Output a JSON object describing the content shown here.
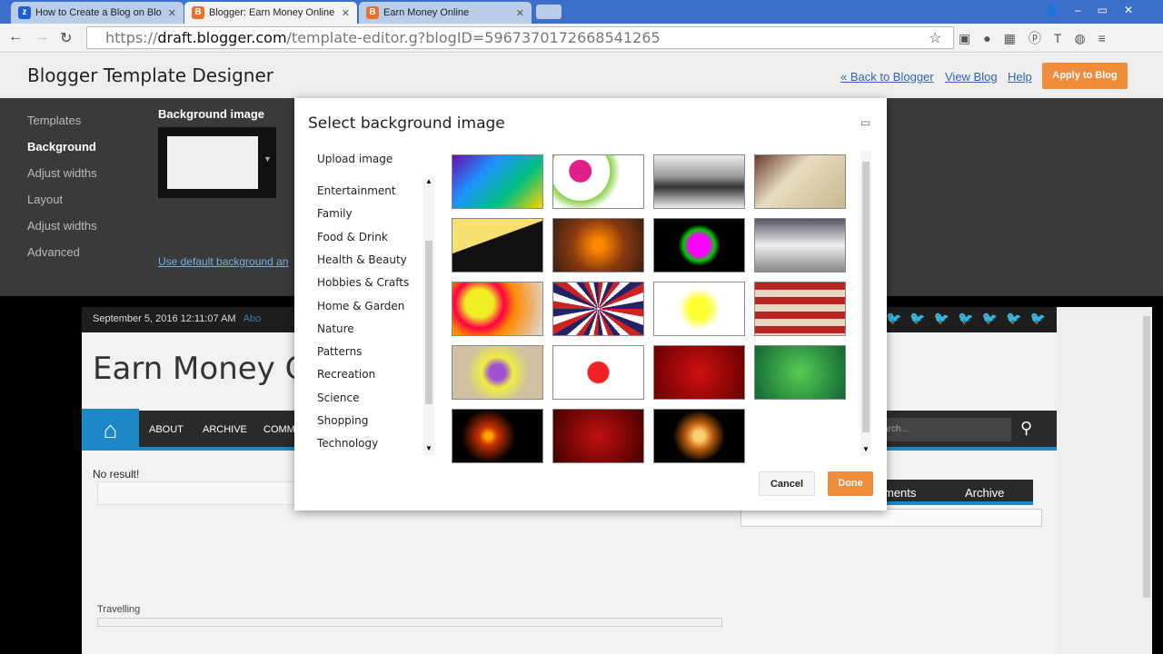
{
  "browser": {
    "tabs": [
      {
        "title": "How to Create a Blog on Blo",
        "icon": "z"
      },
      {
        "title": "Blogger: Earn Money Online",
        "icon": "B"
      },
      {
        "title": "Earn Money Online",
        "icon": "B"
      }
    ],
    "url_scheme": "https://",
    "url_host": "draft.blogger.com",
    "url_path": "/template-editor.g?blogID=5967370172668541265"
  },
  "header": {
    "title": "Blogger Template Designer",
    "back": "« Back to Blogger",
    "view": "View Blog",
    "help": "Help",
    "apply": "Apply to Blog"
  },
  "sidebar": [
    "Templates",
    "Background",
    "Adjust widths",
    "Layout",
    "Adjust widths",
    "Advanced"
  ],
  "editor": {
    "bg_label": "Background image",
    "default_link": "Use default background an"
  },
  "blog": {
    "date": "September 5, 2016 12:11:07 AM",
    "about": "Abo",
    "title": "Earn Money C",
    "nav": [
      "ABOUT",
      "ARCHIVE",
      "COMM"
    ],
    "search": "arch...",
    "no_result": "No result!",
    "travelling": "Travelling",
    "tabs": [
      "ments",
      "Archive"
    ]
  },
  "dialog": {
    "title": "Select background image",
    "upload": "Upload image",
    "categories": [
      "Entertainment",
      "Family",
      "Food & Drink",
      "Health & Beauty",
      "Hobbies & Crafts",
      "Home & Garden",
      "Nature",
      "Patterns",
      "Recreation",
      "Science",
      "Shopping",
      "Technology"
    ],
    "thumbs": [
      "linear-gradient(135deg,#6a0dad,#1e90ff,#00c080,#ffd000)",
      "radial-gradient(circle at 30% 30%,#e0208a 15%,#fff 16%,#fff 40%,#8bd048 41%,#fff 55%)",
      "linear-gradient(#eee,#999 40%,#333 60%,#eee)",
      "linear-gradient(135deg,#6b3a2a,#e8dcc0 40%,#c8b890)",
      "linear-gradient(160deg,#f8e070 40%,#111 41%)",
      "radial-gradient(circle,#f80 10%,#8a3a10 50%,#3a2010)",
      "radial-gradient(circle,#f0f 20%,#0c0 30%,#000 40%)",
      "linear-gradient(#556,#eee 50%,#888)",
      "radial-gradient(circle at 30% 40%,#ee2 20%,#f04 35%,#f80 50%,#ddd)",
      "repeating-conic-gradient(#c22 0 10deg,#fff 10deg 20deg,#226 20deg 30deg)",
      "radial-gradient(circle,#ff3 20%,#fff 40%)",
      "repeating-linear-gradient(#b22 0 8px,#e8d8c0 8px 16px)",
      "radial-gradient(circle,#a050d0 15%,#ee4 30%,#d0c0a0 60%)",
      "radial-gradient(circle,#e22 20%,#fff 22%)",
      "radial-gradient(circle,#d01010,#600)",
      "radial-gradient(circle,#5c5,#163)",
      "radial-gradient(circle at 40% 50%,#fa0 5%,#c30 15%,#000 45%)",
      "radial-gradient(circle,#c01010,#400)",
      "radial-gradient(circle,#ffd070 10%,#c06010 25%,#000 50%)"
    ],
    "cancel": "Cancel",
    "done": "Done"
  },
  "colors": {
    "accent": "#f08c3a",
    "blue": "#1e88c7"
  }
}
